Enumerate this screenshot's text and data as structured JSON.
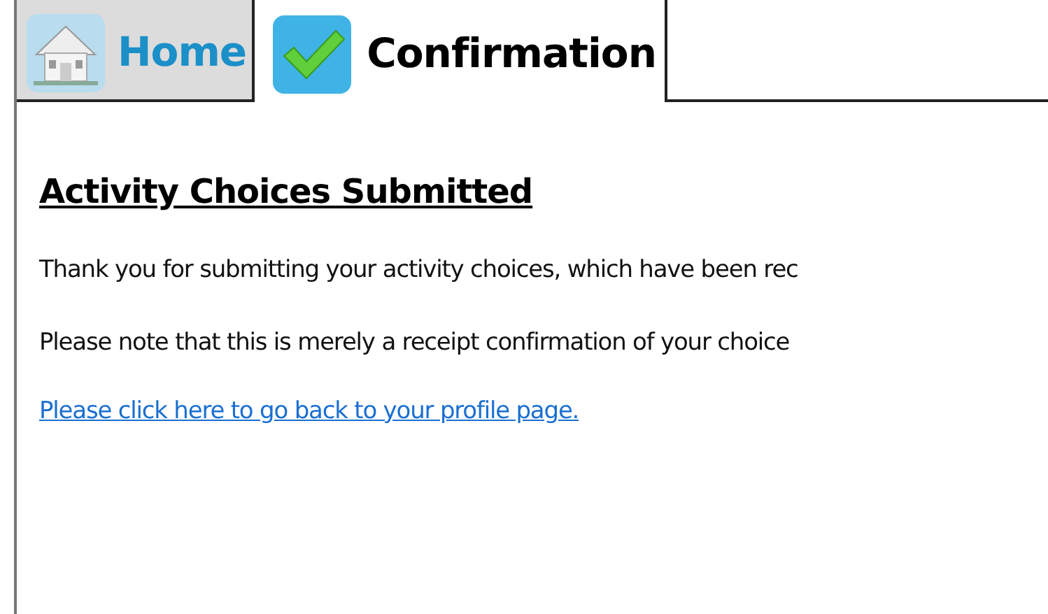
{
  "tabs": [
    {
      "label": "Home",
      "kind": "home",
      "selected": false
    },
    {
      "label": "Confirmation",
      "kind": "check",
      "selected": true
    }
  ],
  "heading": "Activity Choices Submitted",
  "paragraphs": [
    "Thank you for submitting your activity choices, which have been rec",
    "Please note that this is merely a receipt confirmation of your choice"
  ],
  "link": "Please click here to go back to your profile page."
}
